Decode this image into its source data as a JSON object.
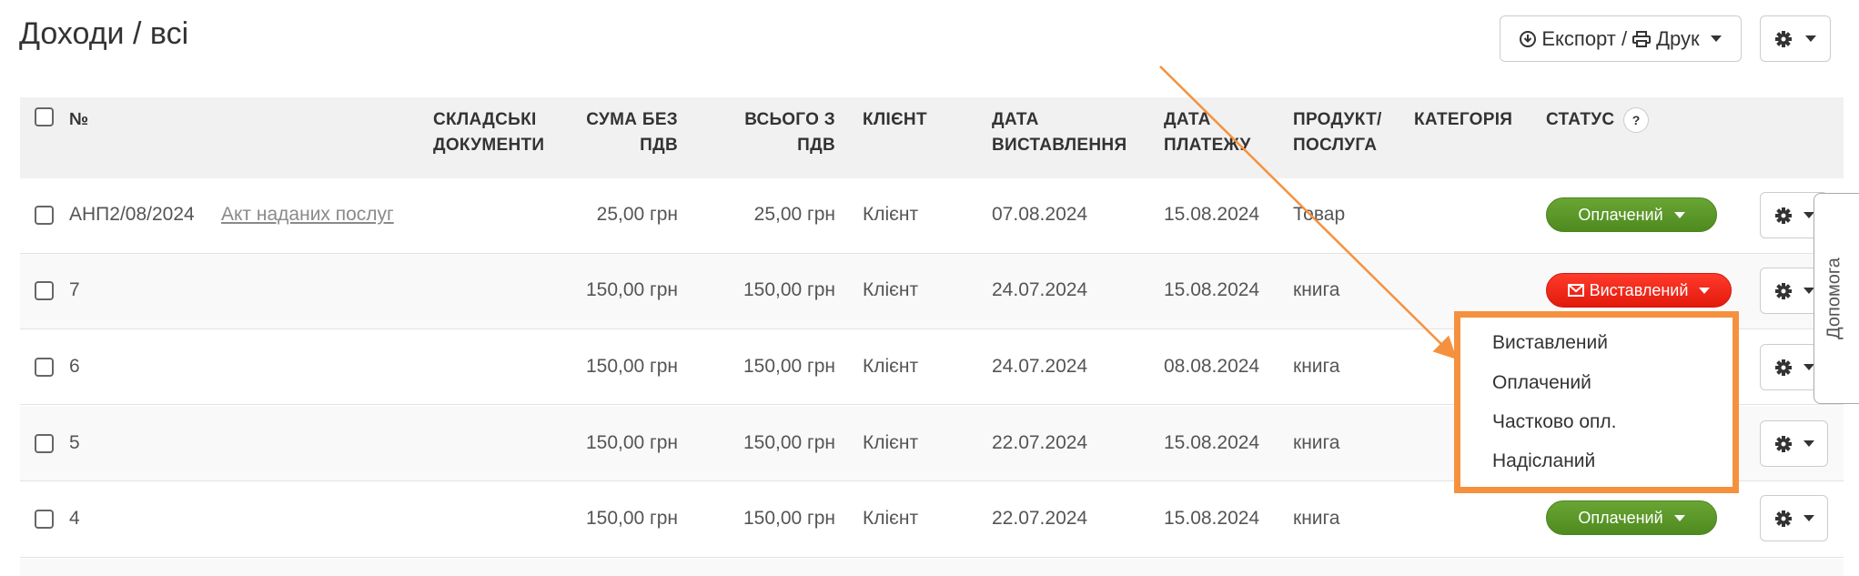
{
  "page_title": "Доходи / всі",
  "toolbar": {
    "export_label": "Експорт / ",
    "print_label": "Друк"
  },
  "table": {
    "columns": {
      "number": "№",
      "warehouse_docs": "СКЛАДСЬКІ ДОКУМЕНТИ",
      "sum_without_vat": "СУМА БЕЗ ПДВ",
      "total_with_vat": "ВСЬОГО З ПДВ",
      "client": "КЛІЄНТ",
      "issue_date": "ДАТА ВИСТАВЛЕННЯ",
      "payment_date": "ДАТА ПЛАТЕЖУ",
      "product_service": "ПРОДУКТ/ ПОСЛУГА",
      "category": "КАТЕГОРІЯ",
      "status": "СТАТУС",
      "status_help": "?"
    },
    "rows": [
      {
        "number": "АНП2/08/2024",
        "doc_link": "Акт наданих послуг",
        "sum": "25,00 грн",
        "total": "25,00 грн",
        "client": "Клієнт",
        "issue_date": "07.08.2024",
        "payment_date": "15.08.2024",
        "product": "Товар",
        "status": "Оплачений"
      },
      {
        "number": "7",
        "doc_link": "",
        "sum": "150,00 грн",
        "total": "150,00 грн",
        "client": "Клієнт",
        "issue_date": "24.07.2024",
        "payment_date": "15.08.2024",
        "product": "книга",
        "status": "Виставлений"
      },
      {
        "number": "6",
        "doc_link": "",
        "sum": "150,00 грн",
        "total": "150,00 грн",
        "client": "Клієнт",
        "issue_date": "24.07.2024",
        "payment_date": "08.08.2024",
        "product": "книга",
        "status": ""
      },
      {
        "number": "5",
        "doc_link": "",
        "sum": "150,00 грн",
        "total": "150,00 грн",
        "client": "Клієнт",
        "issue_date": "22.07.2024",
        "payment_date": "15.08.2024",
        "product": "книга",
        "status": ""
      },
      {
        "number": "4",
        "doc_link": "",
        "sum": "150,00 грн",
        "total": "150,00 грн",
        "client": "Клієнт",
        "issue_date": "22.07.2024",
        "payment_date": "15.08.2024",
        "product": "книга",
        "status": "Оплачений"
      }
    ]
  },
  "status_dropdown": {
    "options": [
      "Виставлений",
      "Оплачений",
      "Частково опл.",
      "Надісланий"
    ]
  },
  "help_tab": "Допомога",
  "colors": {
    "paid_green": "#5a9a27",
    "issued_red": "#f0291b",
    "highlight_orange": "#f5913e",
    "header_bg": "#f1f1f1"
  },
  "icons": [
    "download-icon",
    "print-icon",
    "gear-icon",
    "caret-down-icon",
    "envelope-icon",
    "help-icon"
  ]
}
